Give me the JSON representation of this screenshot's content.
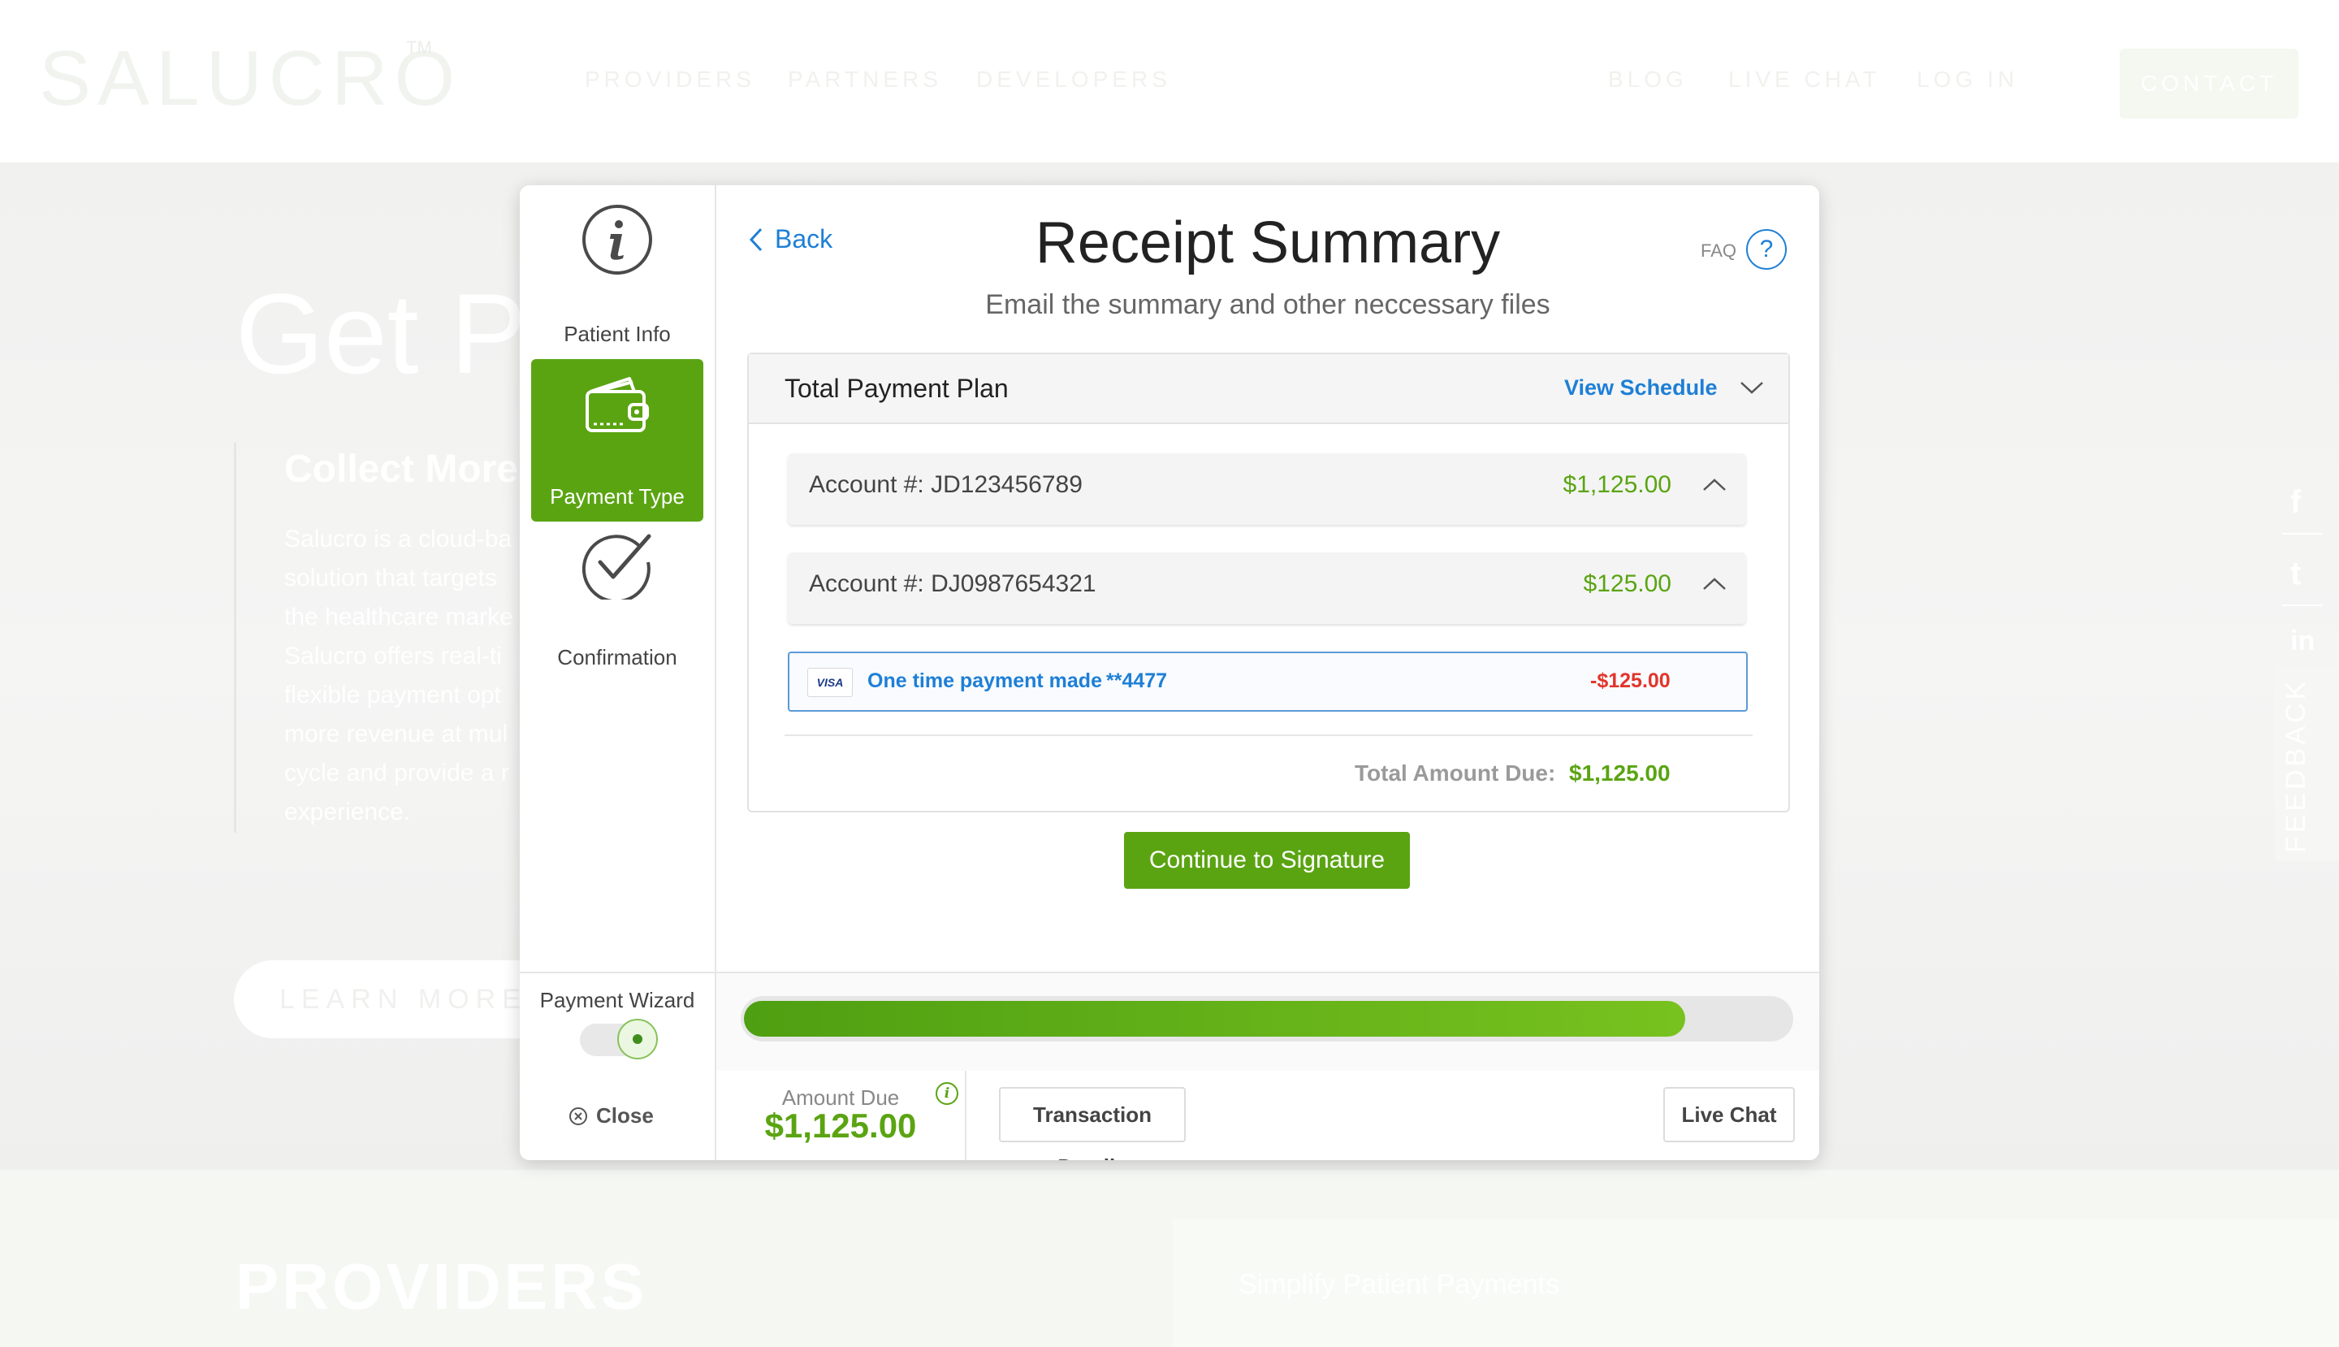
{
  "site": {
    "logo": "SALUCRO",
    "logo_tm": "TM",
    "nav": [
      "PROVIDERS",
      "PARTNERS",
      "DEVELOPERS"
    ],
    "nav_right": [
      "BLOG",
      "LIVE CHAT",
      "LOG IN"
    ],
    "contact": "CONTACT",
    "hero_title": "Get Pa",
    "hero_subtitle": "Collect More",
    "hero_body": [
      "Salucro is a cloud-ba",
      "solution that targets",
      "the healthcare marke",
      "Salucro offers real-ti",
      "flexible payment opt",
      "more revenue at mul",
      "cycle and provide a r",
      "experience."
    ],
    "learn_more": "LEARN MORE",
    "feedback": "FEEDBACK",
    "social": [
      "f",
      "t",
      "in"
    ],
    "lower_title": "PROVIDERS",
    "lower_subtitle": "Simplify Patient Payments"
  },
  "sidebar": {
    "steps": [
      {
        "label": "Patient Info",
        "icon": "info-icon",
        "active": false
      },
      {
        "label": "Payment Type",
        "icon": "wallet-icon",
        "active": true
      },
      {
        "label": "Confirmation",
        "icon": "check-circle-icon",
        "active": false
      }
    ]
  },
  "header": {
    "back": "Back",
    "title": "Receipt Summary",
    "subtitle": "Email the summary and other neccessary files",
    "faq": "FAQ",
    "faq_icon": "?"
  },
  "plan": {
    "title": "Total Payment Plan",
    "view_schedule": "View Schedule",
    "accounts": [
      {
        "label": "Account #: JD123456789",
        "amount": "$1,125.00"
      },
      {
        "label": "Account #: DJ0987654321",
        "amount": "$125.00"
      }
    ],
    "payment": {
      "card_brand": "VISA",
      "text": "One time payment made",
      "card": "**4477",
      "amount": "-$125.00"
    },
    "total_label": "Total Amount Due:",
    "total_value": "$1,125.00"
  },
  "continue_label": "Continue to Signature",
  "wizard": {
    "label": "Payment Wizard",
    "enabled": true,
    "progress": 0.9
  },
  "footer": {
    "close": "Close",
    "amount_due_label": "Amount Due",
    "amount_due_value": "$1,125.00",
    "transaction_details": "Transaction Details",
    "live_chat": "Live Chat"
  },
  "colors": {
    "accent_green": "#5aa412",
    "link_blue": "#1e7fd6",
    "negative_red": "#e2352b"
  }
}
